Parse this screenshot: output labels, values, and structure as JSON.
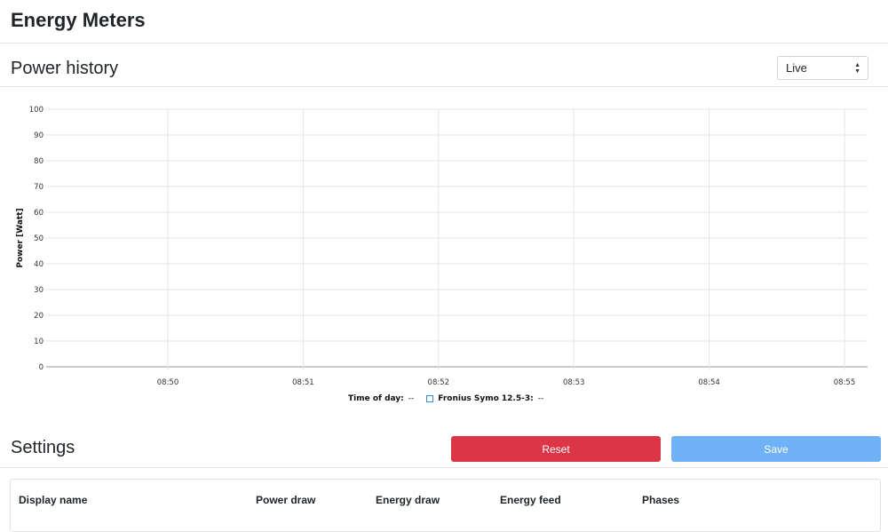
{
  "page": {
    "title": "Energy Meters"
  },
  "power_history": {
    "title": "Power history",
    "range_select": {
      "value": "Live",
      "caret": "▲▼"
    }
  },
  "chart_data": {
    "type": "line",
    "ylabel": "Power [Watt]",
    "xlabel": "",
    "ylim": [
      0,
      100
    ],
    "y_ticks": [
      0,
      10,
      20,
      30,
      40,
      50,
      60,
      70,
      80,
      90,
      100
    ],
    "x_ticks": [
      "08:50",
      "08:51",
      "08:52",
      "08:53",
      "08:54",
      "08:55"
    ],
    "grid": true,
    "series": [
      {
        "name": "Fronius Symo 12.5-3",
        "values": [],
        "color": "#2f8ae0"
      }
    ],
    "legend": {
      "time_label": "Time of day:",
      "time_value": "--",
      "series_label": "Fronius Symo 12.5-3:",
      "series_value": "--"
    }
  },
  "settings": {
    "title": "Settings",
    "reset_label": "Reset",
    "save_label": "Save",
    "columns": [
      "Display name",
      "Power draw",
      "Energy draw",
      "Energy feed",
      "Phases"
    ]
  },
  "colors": {
    "reset": "#dc3545",
    "save": "#6fb2f7",
    "series": "#2f8ae0"
  }
}
